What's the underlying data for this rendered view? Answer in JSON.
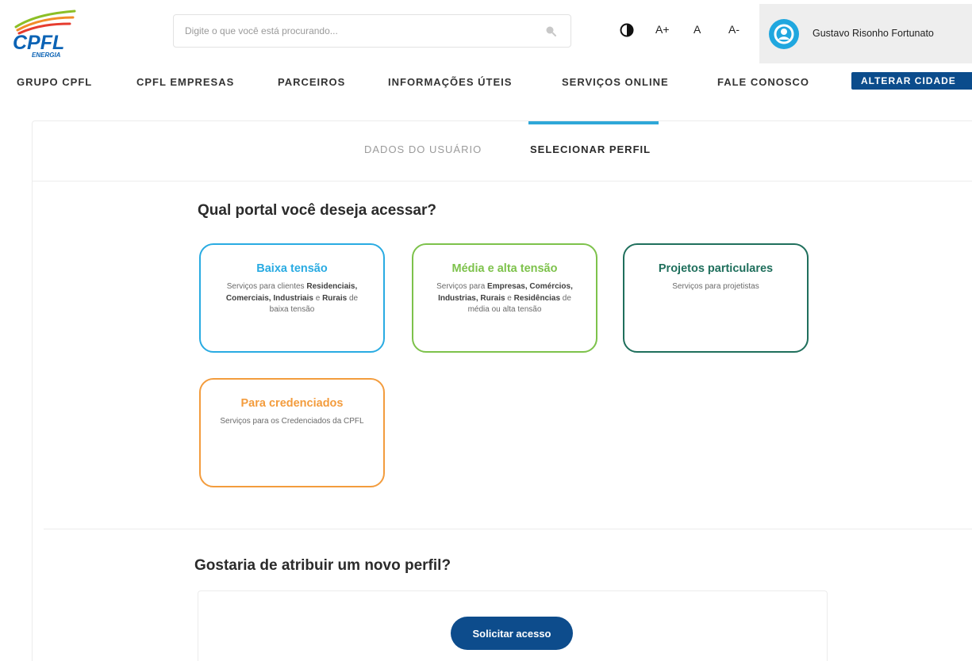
{
  "header": {
    "logo": {
      "text": "CPFL",
      "subtext": "ENERGIA",
      "color": "#0b63b5",
      "swoosh_colors": [
        "#8cbf26",
        "#f28c28",
        "#e63c2f"
      ]
    },
    "search": {
      "placeholder": "Digite o que você está procurando...",
      "value": "",
      "icon": "search-icon"
    },
    "accessibility": {
      "contrast_icon": "contrast-icon",
      "font_increase": "A+",
      "font_default": "A",
      "font_decrease": "A-"
    },
    "user": {
      "name": "Gustavo Risonho Fortunato",
      "avatar_icon": "user-avatar-icon",
      "avatar_color": "#20a7df"
    }
  },
  "nav": {
    "items": [
      {
        "label": "GRUPO CPFL"
      },
      {
        "label": "CPFL EMPRESAS"
      },
      {
        "label": "PARCEIROS"
      },
      {
        "label": "INFORMAÇÕES ÚTEIS"
      },
      {
        "label": "SERVIÇOS ONLINE"
      },
      {
        "label": "FALE CONOSCO"
      }
    ],
    "cta": {
      "label": "ALTERAR CIDADE",
      "color": "#0b4c8c"
    }
  },
  "tabs": {
    "items": [
      {
        "label": "DADOS DO USUÁRIO",
        "active": false
      },
      {
        "label": "SELECIONAR PERFIL",
        "active": true
      }
    ],
    "active_color": "#2ea7d8"
  },
  "portal_section": {
    "title": "Qual portal você deseja acessar?",
    "cards": [
      {
        "title": "Baixa tensão",
        "color": "#29abe2",
        "desc": [
          {
            "text": "Serviços para clientes ",
            "bold": false
          },
          {
            "text": "Residenciais, Comerciais, Industriais",
            "bold": true
          },
          {
            "text": " e ",
            "bold": false
          },
          {
            "text": "Rurais",
            "bold": true
          },
          {
            "text": " de baixa tensão",
            "bold": false
          }
        ]
      },
      {
        "title": "Média e alta tensão",
        "color": "#7dc24b",
        "desc": [
          {
            "text": "Serviços para ",
            "bold": false
          },
          {
            "text": "Empresas, Comércios, Industrias, Rurais",
            "bold": true
          },
          {
            "text": " e ",
            "bold": false
          },
          {
            "text": "Residências",
            "bold": true
          },
          {
            "text": " de média ou alta tensão",
            "bold": false
          }
        ]
      },
      {
        "title": "Projetos particulares",
        "color": "#1f6f5c",
        "desc": [
          {
            "text": "Serviços para projetistas",
            "bold": false
          }
        ]
      },
      {
        "title": "Para credenciados",
        "color": "#f39c3d",
        "desc": [
          {
            "text": "Serviços para os Credenciados da CPFL",
            "bold": false
          }
        ]
      }
    ]
  },
  "new_profile": {
    "title": "Gostaria de atribuir um novo perfil?",
    "button_label": "Solicitar acesso",
    "button_color": "#0d4c8c"
  }
}
